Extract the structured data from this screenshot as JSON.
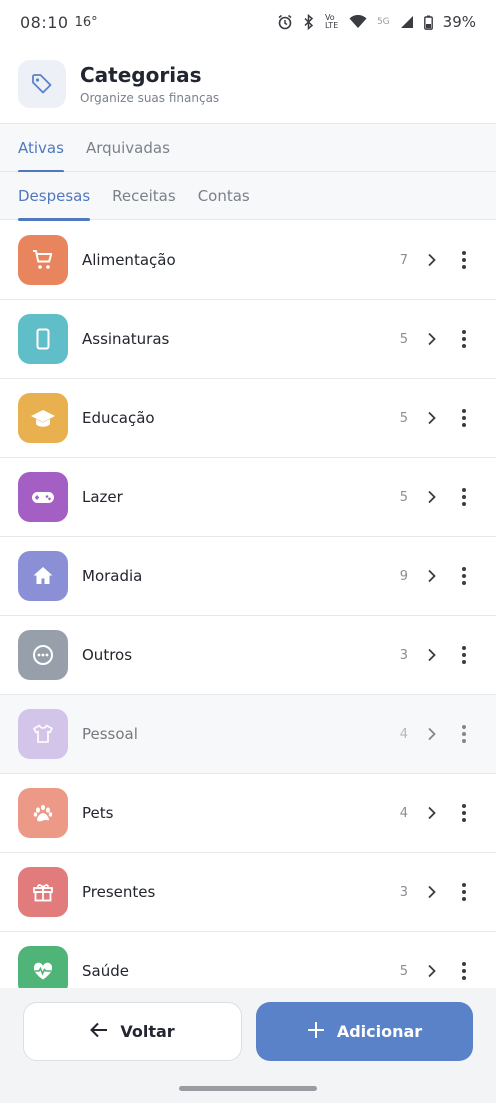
{
  "status": {
    "time": "08:10",
    "temperature": "16°",
    "battery": "39%",
    "icons": [
      "alarm-icon",
      "bluetooth-icon",
      "volte-icon",
      "wifi-icon",
      "5g-icon",
      "signal-icon",
      "battery-icon"
    ],
    "network_label": "5G",
    "volte_label": "Vo LTE"
  },
  "header": {
    "title": "Categorias",
    "subtitle": "Organize suas finanças",
    "icon": "tag-icon"
  },
  "tabs_primary": [
    {
      "label": "Ativas",
      "active": true
    },
    {
      "label": "Arquivadas",
      "active": false
    }
  ],
  "tabs_secondary": [
    {
      "label": "Despesas",
      "active": true
    },
    {
      "label": "Receitas",
      "active": false
    },
    {
      "label": "Contas",
      "active": false
    }
  ],
  "categories": [
    {
      "name": "Alimentação",
      "count": "7",
      "icon": "cart-icon",
      "color": "#e8855f"
    },
    {
      "name": "Assinaturas",
      "count": "5",
      "icon": "phone-icon",
      "color": "#5fbec7"
    },
    {
      "name": "Educação",
      "count": "5",
      "icon": "graduation-cap-icon",
      "color": "#e9b04f"
    },
    {
      "name": "Lazer",
      "count": "5",
      "icon": "gamepad-icon",
      "color": "#a45fc4"
    },
    {
      "name": "Moradia",
      "count": "9",
      "icon": "home-icon",
      "color": "#8b8fd6"
    },
    {
      "name": "Outros",
      "count": "3",
      "icon": "more-circle-icon",
      "color": "#97a0aa"
    },
    {
      "name": "Pessoal",
      "count": "4",
      "icon": "shirt-icon",
      "color": "#b79ade",
      "archived_look": true
    },
    {
      "name": "Pets",
      "count": "4",
      "icon": "paw-icon",
      "color": "#ec9a87"
    },
    {
      "name": "Presentes",
      "count": "3",
      "icon": "gift-icon",
      "color": "#e27b7b"
    },
    {
      "name": "Saúde",
      "count": "5",
      "icon": "heart-pulse-icon",
      "color": "#4fb477"
    }
  ],
  "buttons": {
    "back_label": "Voltar",
    "add_label": "Adicionar",
    "back_icon": "arrow-left-icon",
    "add_icon": "plus-icon"
  },
  "colors": {
    "accent": "#4f78c1",
    "primary_button": "#5a82c9"
  }
}
